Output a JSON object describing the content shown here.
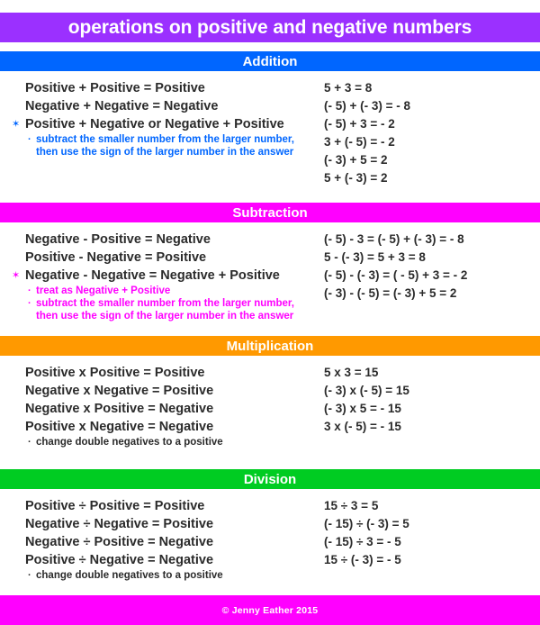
{
  "title": "operations on positive and negative numbers",
  "colors": {
    "title_bg": "#9B30FF",
    "addition": "#0066FF",
    "subtraction": "#FF00FF",
    "multiplication": "#FF9900",
    "division": "#00CC22",
    "footer_bg": "#FF00FF",
    "text": "#2b2b2b",
    "header_text": "#FFFFFF"
  },
  "sections": [
    {
      "name": "addition",
      "header": "Addition",
      "accent": "#0066FF",
      "rules": [
        {
          "text": "Positive + Positive = Positive",
          "star": false
        },
        {
          "text": "Negative + Negative = Negative",
          "star": false
        },
        {
          "text": "Positive + Negative or Negative + Positive",
          "star": true
        }
      ],
      "notes": [
        {
          "bullet": "·",
          "line1": "subtract the smaller number from the larger number,",
          "line2": "then use the sign of the larger number in the answer"
        }
      ],
      "examples": [
        "5 + 3 = 8",
        "(- 5) + (- 3) = - 8",
        "(- 5) + 3 = - 2",
        "3 + (- 5) = - 2",
        "(- 3) + 5 = 2",
        "5 + (- 3) = 2"
      ]
    },
    {
      "name": "subtraction",
      "header": "Subtraction",
      "accent": "#FF00FF",
      "rules": [
        {
          "text": "Negative - Positive = Negative",
          "star": false
        },
        {
          "text": "Positive - Negative = Positive",
          "star": false
        },
        {
          "text": "Negative - Negative = Negative + Positive",
          "star": true
        }
      ],
      "notes": [
        {
          "bullet": "·",
          "line1": "treat as Negative + Positive",
          "line2": ""
        },
        {
          "bullet": "·",
          "line1": "subtract the smaller number from the larger number,",
          "line2": "then use the sign of the larger number in the answer"
        }
      ],
      "examples": [
        "(- 5) - 3 = (- 5) + (- 3) = - 8",
        "5 - (- 3) = 5 + 3 = 8",
        "(- 5) - (- 3) = ( - 5) + 3 = - 2",
        "(- 3) - (- 5) = (- 3) + 5 = 2"
      ]
    },
    {
      "name": "multiplication",
      "header": "Multiplication",
      "accent": "#FF9900",
      "rules": [
        {
          "text": "Positive x Positive = Positive",
          "star": false
        },
        {
          "text": "Negative x Negative = Positive",
          "star": false
        },
        {
          "text": "Negative x Positive = Negative",
          "star": false
        },
        {
          "text": "Positive x Negative = Negative",
          "star": false
        }
      ],
      "notes": [
        {
          "bullet": "·",
          "line1": "change double negatives to a positive",
          "line2": ""
        }
      ],
      "examples": [
        "5 x 3 = 15",
        "(- 3) x (- 5) = 15",
        "(- 3) x 5 = - 15",
        "3 x (- 5) = - 15"
      ]
    },
    {
      "name": "division",
      "header": "Division",
      "accent": "#00CC22",
      "rules": [
        {
          "text": "Positive ÷ Positive = Positive",
          "star": false
        },
        {
          "text": "Negative ÷ Negative = Positive",
          "star": false
        },
        {
          "text": "Negative ÷ Positive = Negative",
          "star": false
        },
        {
          "text": "Positive ÷ Negative = Negative",
          "star": false
        }
      ],
      "notes": [
        {
          "bullet": "·",
          "line1": "change double negatives to a positive",
          "line2": ""
        }
      ],
      "examples": [
        "15 ÷ 3 = 5",
        "(- 15) ÷ (- 3) = 5",
        "(- 15) ÷ 3 = - 5",
        "15 ÷ (- 3) = - 5"
      ]
    }
  ],
  "star_glyph": "✶",
  "footer": "© Jenny Eather 2015"
}
